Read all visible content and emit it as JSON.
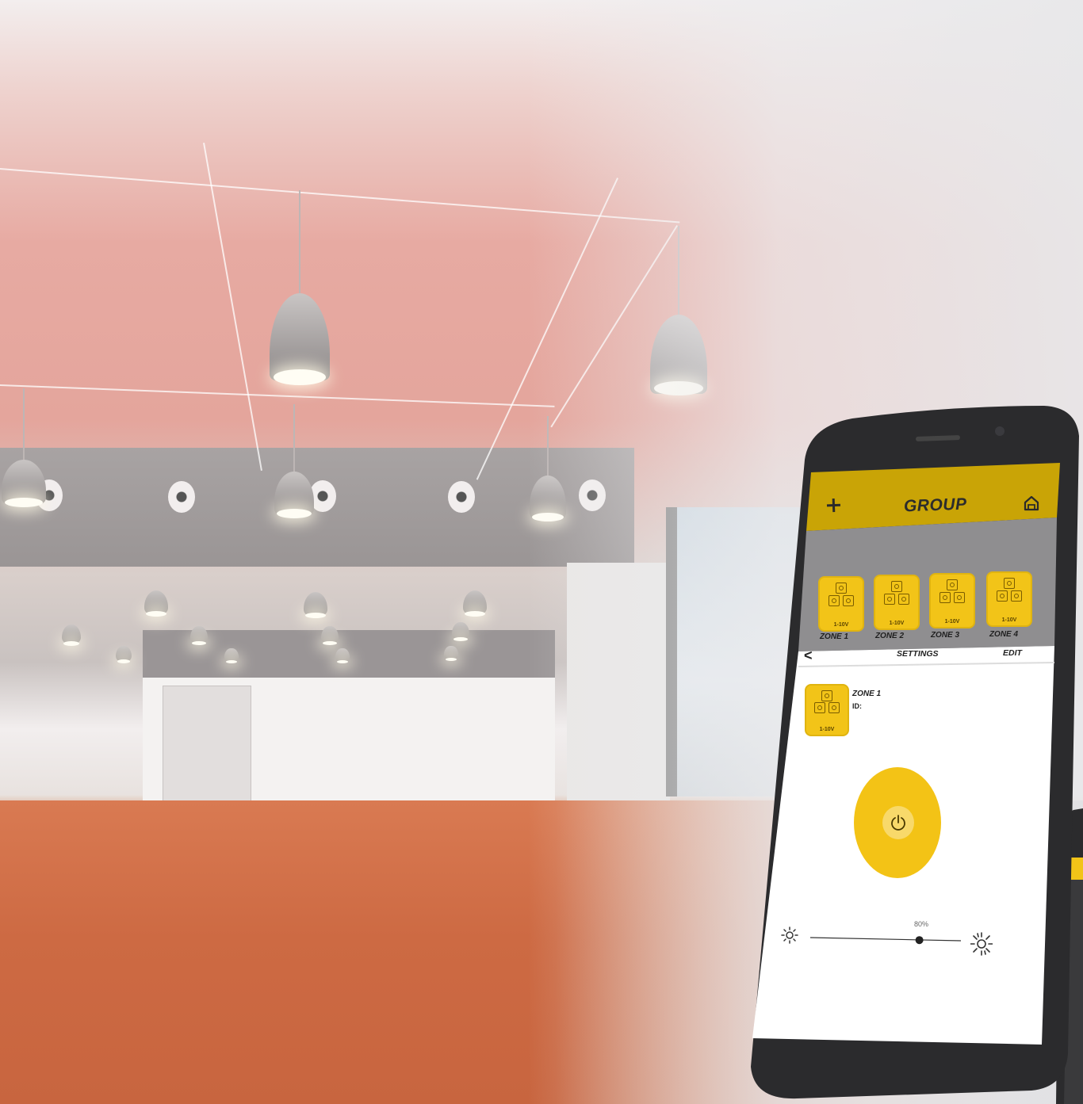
{
  "app": {
    "title": "GROUP",
    "add_label": "+",
    "home_icon": "home-icon"
  },
  "zones": [
    {
      "label": "ZONE 1",
      "tag": "1-10V"
    },
    {
      "label": "ZONE 2",
      "tag": "1-10V"
    },
    {
      "label": "ZONE 3",
      "tag": "1-10V"
    },
    {
      "label": "ZONE 4",
      "tag": "1-10V"
    }
  ],
  "settings_bar": {
    "back_label": "<",
    "title": "SETTINGS",
    "edit_label": "EDIT"
  },
  "detail": {
    "name": "ZONE 1",
    "id_label": "ID:",
    "tag": "1-10V"
  },
  "power": {
    "icon": "power-icon",
    "state_color": "#f3c316"
  },
  "dimmer": {
    "value_label": "80%",
    "value": 0.8,
    "low_icon": "sun-dim-icon",
    "high_icon": "sun-bright-icon"
  },
  "colors": {
    "accent": "#f2c418",
    "header": "#c9a406",
    "phone_frame": "#2b2b2d"
  }
}
